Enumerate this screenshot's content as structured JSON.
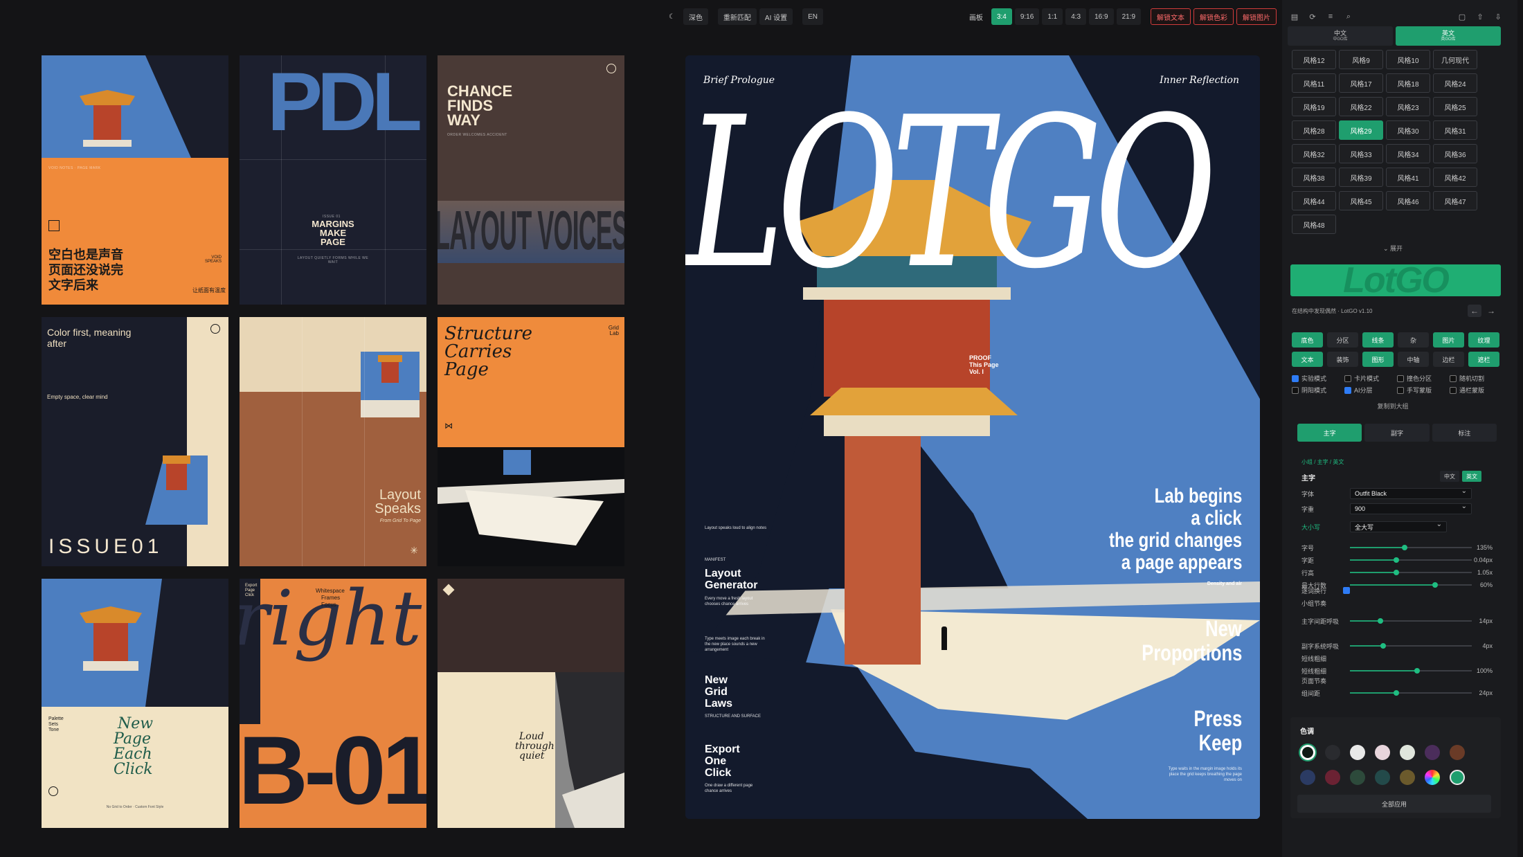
{
  "toolbar": {
    "moon_icon": "☾",
    "theme": "深色",
    "rematch": "重新匹配",
    "ai_settings": "AI 设置",
    "lang": "EN",
    "canvas_label": "画板",
    "ratios": [
      "3:4",
      "9:16",
      "1:1",
      "4:3",
      "16:9",
      "21:9"
    ],
    "active_ratio": "3:4",
    "unlock_text": "解锁文本",
    "unlock_color": "解锁色彩",
    "unlock_image": "解锁图片"
  },
  "gallery": {
    "c1": {
      "cn1": "空白也是声音",
      "cn2": "页面还没说完",
      "cn3": "文字后来",
      "sub": "让纸面有温度",
      "side": "VOID SPEAKS"
    },
    "c2": {
      "big": "PDL",
      "title1": "MARGINS",
      "title2": "MAKE",
      "title3": "PAGE",
      "issue": "ISSUE 01"
    },
    "c3": {
      "t1": "CHANCE",
      "t2": "FINDS",
      "t3": "WAY",
      "sub": "ORDER WELCOMES ACCIDENT",
      "big": "LAYOUT VOICES"
    },
    "c4": {
      "t1": "Color first, meaning",
      "t2": "after",
      "mid": "Empty space, clear mind",
      "big": "ISSUE01"
    },
    "c5": {
      "t1": "Layout",
      "t2": "Speaks",
      "sub": "From Grid To Page"
    },
    "c6": {
      "t1": "Structure",
      "t2": "Carries",
      "t3": "Page",
      "tag": "Grid Lab"
    },
    "c7": {
      "t1": "New",
      "t2": "Page",
      "t3": "Each",
      "t4": "Click",
      "side1": "Palette",
      "side2": "Sets",
      "side3": "Tone",
      "foot": "No Grid to Order · Custom Font Style"
    },
    "c8": {
      "script": "right",
      "big": "B-01",
      "top1": "Whitespace",
      "top2": "Frames",
      "top3": "Focus",
      "left1": "Export",
      "left2": "Page",
      "left3": "Click"
    },
    "c9": {
      "t1": "Loud",
      "t2": "through",
      "t3": "quiet"
    }
  },
  "poster": {
    "sig_left": "Brief Prologue",
    "sig_right": "Inner Reflection",
    "title": "LOTGO",
    "proof1": "PROOF",
    "proof2": "This Page",
    "proof3": "Vol. I",
    "h1": "Lab begins",
    "h2": "a click",
    "h3": "the grid changes",
    "h4": "a page appears",
    "density": "Density and air",
    "layout_gen1": "Layout",
    "layout_gen2": "Generator",
    "layout_kicker": "MANIFEST",
    "new1": "New",
    "new2": "Proportions",
    "grid1": "New",
    "grid2": "Grid",
    "grid3": "Laws",
    "grid_sub": "STRUCTURE AND SURFACE",
    "press1": "Press",
    "press2": "Keep",
    "exp1": "Export",
    "exp2": "One",
    "exp3": "Click",
    "small_a": "Layout speaks loud to align notes",
    "small_b": "Every move a fresh layout chooses chance arrives",
    "small_c": "Type meets image each break in the new place sounds a new arrangement",
    "small_d": "One draw a different page chance arrives",
    "small_e": "Type waits in the margin image holds its place the grid keeps breathing the page moves on"
  },
  "panel": {
    "icons": [
      "doc-icon",
      "refresh-icon",
      "menu-icon",
      "search-icon",
      "file-icon",
      "upload-icon",
      "download-icon"
    ],
    "lang_cn": "中文",
    "lang_cn_sub": "中GO库",
    "lang_en": "英文",
    "lang_en_sub": "英GO库",
    "styles": [
      "风格12",
      "风格9",
      "风格10",
      "几何现代",
      "风格11",
      "风格17",
      "风格18",
      "风格24",
      "风格19",
      "风格22",
      "风格23",
      "风格25",
      "风格28",
      "风格29",
      "风格30",
      "风格31",
      "风格32",
      "风格33",
      "风格34",
      "风格36",
      "风格38",
      "风格39",
      "风格41",
      "风格42",
      "风格44",
      "风格45",
      "风格46",
      "风格47",
      "风格48"
    ],
    "active_style": "风格29",
    "expand": "⌄ 展开",
    "logo": "LotGO",
    "tagline": "在结构中发现偶然 · LotGO v1.10",
    "layers": [
      "底色",
      "分区",
      "线条",
      "杂",
      "图片",
      "纹理",
      "文本",
      "装饰",
      "图形",
      "中轴",
      "边栏",
      "遮栏"
    ],
    "layers_on": [
      true,
      false,
      true,
      false,
      true,
      true,
      true,
      false,
      true,
      false,
      false,
      true
    ],
    "checks": [
      {
        "label": "实验模式",
        "on": true
      },
      {
        "label": "卡片模式",
        "on": false
      },
      {
        "label": "撞色分区",
        "on": false
      },
      {
        "label": "随机切割",
        "on": false
      },
      {
        "label": "阴阳模式",
        "on": false
      },
      {
        "label": "AI分层",
        "on": true
      },
      {
        "label": "手写蒙版",
        "on": false
      },
      {
        "label": "通栏蒙版",
        "on": false
      }
    ],
    "copy_link": "复制到大组",
    "type_tabs": [
      "主字",
      "副字",
      "标注"
    ],
    "crumb": "小组 / 主字 / 英文",
    "sec_title": "主字",
    "mini_cn": "中文",
    "mini_en": "英文",
    "font_label": "字体",
    "font_value": "Outfit Black",
    "weight_label": "字重",
    "weight_value": "900",
    "case_label": "大小写",
    "case_value": "全大写",
    "sliders": [
      {
        "label": "字号",
        "value": "135%",
        "fill": 0.45
      },
      {
        "label": "字距",
        "value": "0.04px",
        "fill": 0.38
      },
      {
        "label": "行高",
        "value": "1.05x",
        "fill": 0.38
      },
      {
        "label": "最大行数",
        "value": "60%",
        "fill": 0.7
      },
      {
        "label": "主字间距呼吸",
        "value": "14px",
        "fill": 0.25
      },
      {
        "label": "副字系统呼吸",
        "value": "4px",
        "fill": 0.27
      },
      {
        "label": "短线粗细",
        "value": "100%",
        "fill": 0.55
      },
      {
        "label": "组间距",
        "value": "24px",
        "fill": 0.38
      }
    ],
    "wrap_label": "逐词换行",
    "rhythm_label": "小组节奏",
    "stroke_label": "短线粗细",
    "page_rhythm": "页面节奏",
    "colors_title": "色调",
    "swatches": [
      "#0f1a15",
      "#2a2b2f",
      "#e8e8e8",
      "#e8d5dc",
      "#dfe5dc",
      "#4b2d5b",
      "#6a3b27",
      "#2b3b63",
      "#6b2233",
      "#2d4a3b",
      "#234a4a",
      "#6b5a2c",
      "rainbow",
      "#1f9e6e"
    ],
    "apply_all": "全部应用"
  }
}
